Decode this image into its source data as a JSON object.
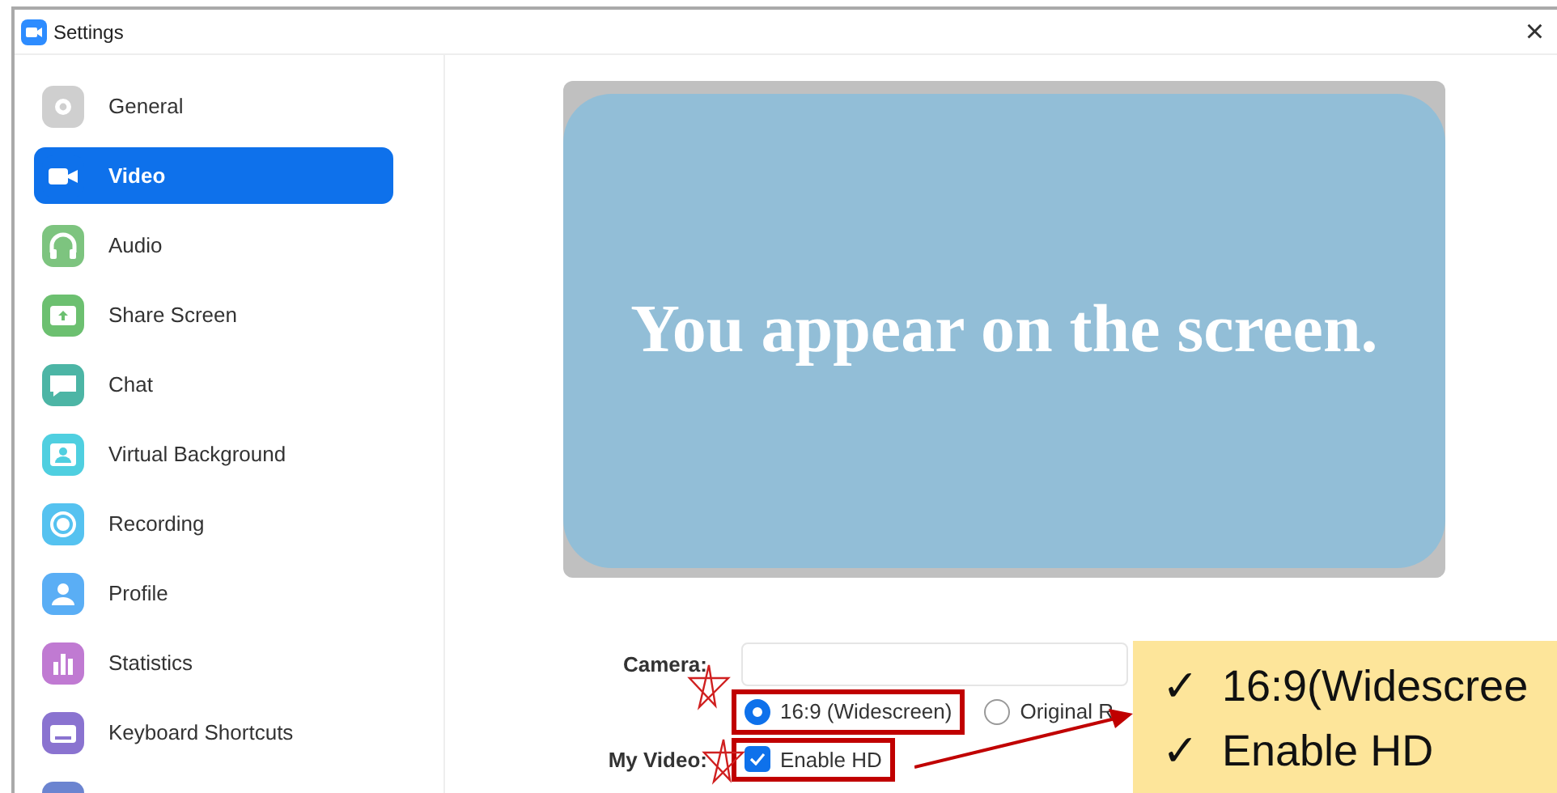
{
  "window": {
    "title": "Settings",
    "close": "×"
  },
  "sidebar": {
    "items": [
      {
        "kind": "gear",
        "label": "General",
        "color": "#cfcfcf",
        "selected": false
      },
      {
        "kind": "camera",
        "label": "Video",
        "color": "#ffffff",
        "selected": true
      },
      {
        "kind": "headphones",
        "label": "Audio",
        "color": "#7dc47f",
        "selected": false
      },
      {
        "kind": "share",
        "label": "Share Screen",
        "color": "#6cc070",
        "selected": false
      },
      {
        "kind": "chat",
        "label": "Chat",
        "color": "#4cb5a5",
        "selected": false
      },
      {
        "kind": "background",
        "label": "Virtual Background",
        "color": "#4fcfe0",
        "selected": false
      },
      {
        "kind": "record",
        "label": "Recording",
        "color": "#55c2f0",
        "selected": false
      },
      {
        "kind": "profile",
        "label": "Profile",
        "color": "#5aaef5",
        "selected": false
      },
      {
        "kind": "stats",
        "label": "Statistics",
        "color": "#c07ad2",
        "selected": false
      },
      {
        "kind": "keyboard",
        "label": "Keyboard Shortcuts",
        "color": "#8a73d0",
        "selected": false
      },
      {
        "kind": "more",
        "color": "#6b84d0"
      }
    ]
  },
  "preview": {
    "message": "You appear on the screen."
  },
  "camera": {
    "label": "Camera:"
  },
  "ratio_options": [
    {
      "label": "16:9 (Widescreen)",
      "selected": true,
      "highlighted": true
    },
    {
      "label": "Original R",
      "selected": false
    }
  ],
  "my_video": {
    "label": "My Video:",
    "options": [
      {
        "label": "Enable HD",
        "checked": true,
        "highlighted": true
      }
    ]
  },
  "callout": {
    "items": [
      {
        "mark": "✓",
        "text": "16:9(Widescree"
      },
      {
        "mark": "✓",
        "text": "Enable HD"
      }
    ]
  }
}
